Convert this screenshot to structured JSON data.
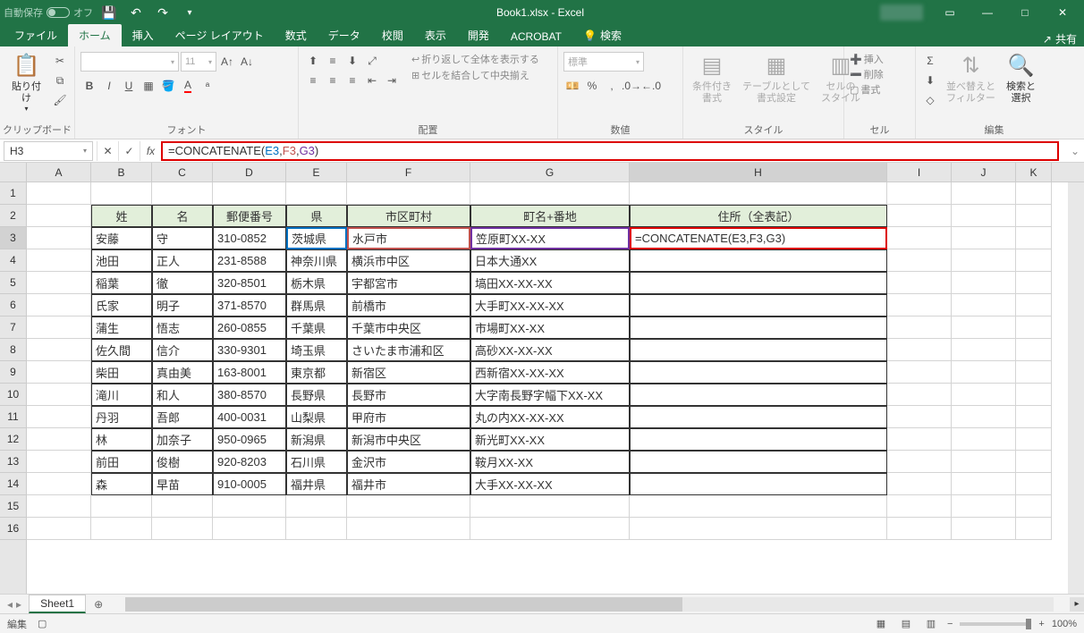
{
  "title_bar": {
    "autosave_label": "自動保存",
    "autosave_state": "オフ",
    "document_title": "Book1.xlsx - Excel"
  },
  "tabs": {
    "items": [
      "ファイル",
      "ホーム",
      "挿入",
      "ページ レイアウト",
      "数式",
      "データ",
      "校閲",
      "表示",
      "開発",
      "ACROBAT"
    ],
    "active_index": 1,
    "tell_me": "検索",
    "share": "共有"
  },
  "ribbon": {
    "clipboard": {
      "paste": "貼り付け",
      "label": "クリップボード"
    },
    "font": {
      "size": "11",
      "label": "フォント"
    },
    "alignment": {
      "wrap": "折り返して全体を表示する",
      "merge": "セルを結合して中央揃え",
      "label": "配置"
    },
    "number": {
      "format": "標準",
      "label": "数値"
    },
    "styles": {
      "cond": "条件付き\n書式",
      "table": "テーブルとして\n書式設定",
      "cell": "セルの\nスタイル",
      "label": "スタイル"
    },
    "cells": {
      "insert": "挿入",
      "delete": "削除",
      "format": "書式",
      "label": "セル"
    },
    "editing": {
      "sort": "並べ替えと\nフィルター",
      "find": "検索と\n選択",
      "label": "編集"
    }
  },
  "formula_bar": {
    "name_box": "H3",
    "formula": "=CONCATENATE(E3,F3,G3)"
  },
  "grid": {
    "columns": [
      "A",
      "B",
      "C",
      "D",
      "E",
      "F",
      "G",
      "H",
      "I",
      "J",
      "K"
    ],
    "selected_col": "H",
    "selected_row": 3,
    "headers": {
      "B": "姓",
      "C": "名",
      "D": "郵便番号",
      "E": "県",
      "F": "市区町村",
      "G": "町名+番地",
      "H": "住所（全表記）"
    },
    "rows": [
      {
        "n": 3,
        "B": "安藤",
        "C": "守",
        "D": "310-0852",
        "E": "茨城県",
        "F": "水戸市",
        "G": "笠原町XX-XX",
        "H": "=CONCATENATE(E3,F3,G3)"
      },
      {
        "n": 4,
        "B": "池田",
        "C": "正人",
        "D": "231-8588",
        "E": "神奈川県",
        "F": "横浜市中区",
        "G": "日本大通XX",
        "H": ""
      },
      {
        "n": 5,
        "B": "稲葉",
        "C": "徹",
        "D": "320-8501",
        "E": "栃木県",
        "F": "宇都宮市",
        "G": "塙田XX-XX-XX",
        "H": ""
      },
      {
        "n": 6,
        "B": "氏家",
        "C": "明子",
        "D": "371-8570",
        "E": "群馬県",
        "F": "前橋市",
        "G": "大手町XX-XX-XX",
        "H": ""
      },
      {
        "n": 7,
        "B": "蒲生",
        "C": "悟志",
        "D": "260-0855",
        "E": "千葉県",
        "F": "千葉市中央区",
        "G": "市場町XX-XX",
        "H": ""
      },
      {
        "n": 8,
        "B": "佐久間",
        "C": "信介",
        "D": "330-9301",
        "E": "埼玉県",
        "F": "さいたま市浦和区",
        "G": "高砂XX-XX-XX",
        "H": ""
      },
      {
        "n": 9,
        "B": "柴田",
        "C": "真由美",
        "D": "163-8001",
        "E": "東京都",
        "F": "新宿区",
        "G": "西新宿XX-XX-XX",
        "H": ""
      },
      {
        "n": 10,
        "B": "滝川",
        "C": "和人",
        "D": "380-8570",
        "E": "長野県",
        "F": "長野市",
        "G": "大字南長野字幅下XX-XX",
        "H": ""
      },
      {
        "n": 11,
        "B": "丹羽",
        "C": "吾郎",
        "D": "400-0031",
        "E": "山梨県",
        "F": "甲府市",
        "G": "丸の内XX-XX-XX",
        "H": ""
      },
      {
        "n": 12,
        "B": "林",
        "C": "加奈子",
        "D": "950-0965",
        "E": "新潟県",
        "F": "新潟市中央区",
        "G": "新光町XX-XX",
        "H": ""
      },
      {
        "n": 13,
        "B": "前田",
        "C": "俊樹",
        "D": "920-8203",
        "E": "石川県",
        "F": "金沢市",
        "G": "鞍月XX-XX",
        "H": ""
      },
      {
        "n": 14,
        "B": "森",
        "C": "早苗",
        "D": "910-0005",
        "E": "福井県",
        "F": "福井市",
        "G": "大手XX-XX-XX",
        "H": ""
      }
    ]
  },
  "sheet_tabs": {
    "active": "Sheet1"
  },
  "status_bar": {
    "mode": "編集",
    "zoom": "100%"
  }
}
